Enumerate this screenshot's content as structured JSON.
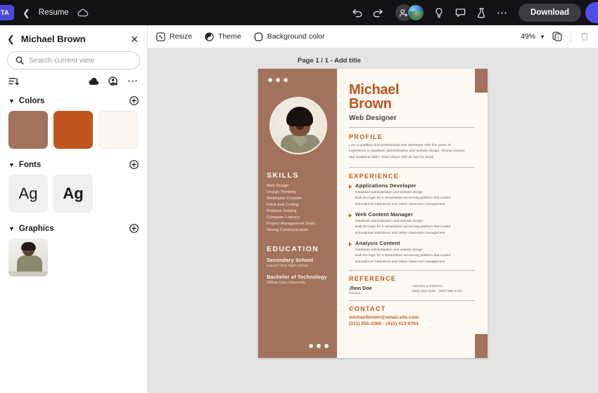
{
  "topbar": {
    "brand_tag": "TA",
    "back_icon": "back-chevron-icon",
    "doc_name": "Resume",
    "cloud_icon": "cloud-icon",
    "undo_icon": "undo-icon",
    "redo_icon": "redo-icon",
    "share_icon": "add-person-icon",
    "avatar_icon": "user-avatar",
    "ideas_icon": "lightbulb-icon",
    "comment_icon": "comment-icon",
    "beta_icon": "flask-icon",
    "more_icon": "more-options-icon",
    "download_label": "Download"
  },
  "panel": {
    "back_icon": "back-chevron-icon",
    "title": "Michael Brown",
    "close_icon": "close-icon",
    "search_placeholder": "Search current view",
    "search_value": "",
    "search_icon": "search-icon",
    "sort_icon": "sort-filter-icon",
    "cloud_icon": "cloud-icon",
    "person_add_icon": "person-add-icon",
    "more_icon": "more-options-icon",
    "sections": [
      {
        "title": "Colors",
        "add_icon": "add-circle-icon",
        "swatches": [
          "#a2725d",
          "#c1551f",
          "#faf6ef"
        ]
      },
      {
        "title": "Fonts",
        "add_icon": "add-circle-icon",
        "tiles": [
          "Ag",
          "Ag"
        ]
      },
      {
        "title": "Graphics",
        "add_icon": "add-circle-icon"
      }
    ]
  },
  "canvas_toolbar": {
    "resize_label": "Resize",
    "resize_icon": "resize-icon",
    "theme_label": "Theme",
    "theme_icon": "theme-icon",
    "background_label": "Background color",
    "background_icon": "background-color-icon",
    "zoom_level": "49%",
    "zoom_chevron_icon": "chevron-down-icon",
    "duplicate_icon": "duplicate-page-icon",
    "delete_icon": "trash-icon"
  },
  "canvas": {
    "page_label": "Page 1 / 1 - Add title"
  },
  "resume": {
    "first_name": "Michael",
    "last_name": "Brown",
    "role": "Web Designer",
    "profile_heading": "PROFILE",
    "profile_text": "I am a qualified and professional web developer with five years of experience in database administration and website design. Strong creative and analytical skills. Team player with an eye for detail.",
    "skills_heading": "SKILLS",
    "skills": [
      "Web Design",
      "Design Thinking",
      "Wireframe Creation",
      "Front End Coding",
      "Problem-Solving",
      "Computer Literacy",
      "Project Management Tools",
      "Strong Communication"
    ],
    "education_heading": "EDUCATION",
    "education": [
      {
        "degree": "Secondary School",
        "school": "Locust View High school"
      },
      {
        "degree": "Bachelor of Technology",
        "school": "Willow Oaks University"
      }
    ],
    "experience_heading": "EXPERIENCE",
    "experience": [
      {
        "title": "Applications Developer",
        "lines": [
          "Database administration and website design",
          "Built the logic for a streamlined ad-serving platform that scaled",
          "Educational institutions and online classroom management"
        ]
      },
      {
        "title": "Web Content Manager",
        "lines": [
          "Database administration and website design",
          "Built the logic for a streamlined ad-serving platform that scaled",
          "Educational institutions and online classroom management"
        ]
      },
      {
        "title": "Analysis Content",
        "lines": [
          "Database administration and website design",
          "Built the logic for a streamlined ad-serving platform that scaled",
          "Educational institutions and online classroom management"
        ]
      }
    ],
    "reference_heading": "REFERENCE",
    "reference": {
      "name": "Jhon Doe",
      "position": "Director",
      "company": "Aldmans & Partners",
      "phones": "(555) 555-3145 - (560) 555-4160"
    },
    "contact_heading": "CONTACT",
    "email": "michaelbrown@email.site.com",
    "phones": "(311) 555-2368 - (415) 413-0703"
  }
}
